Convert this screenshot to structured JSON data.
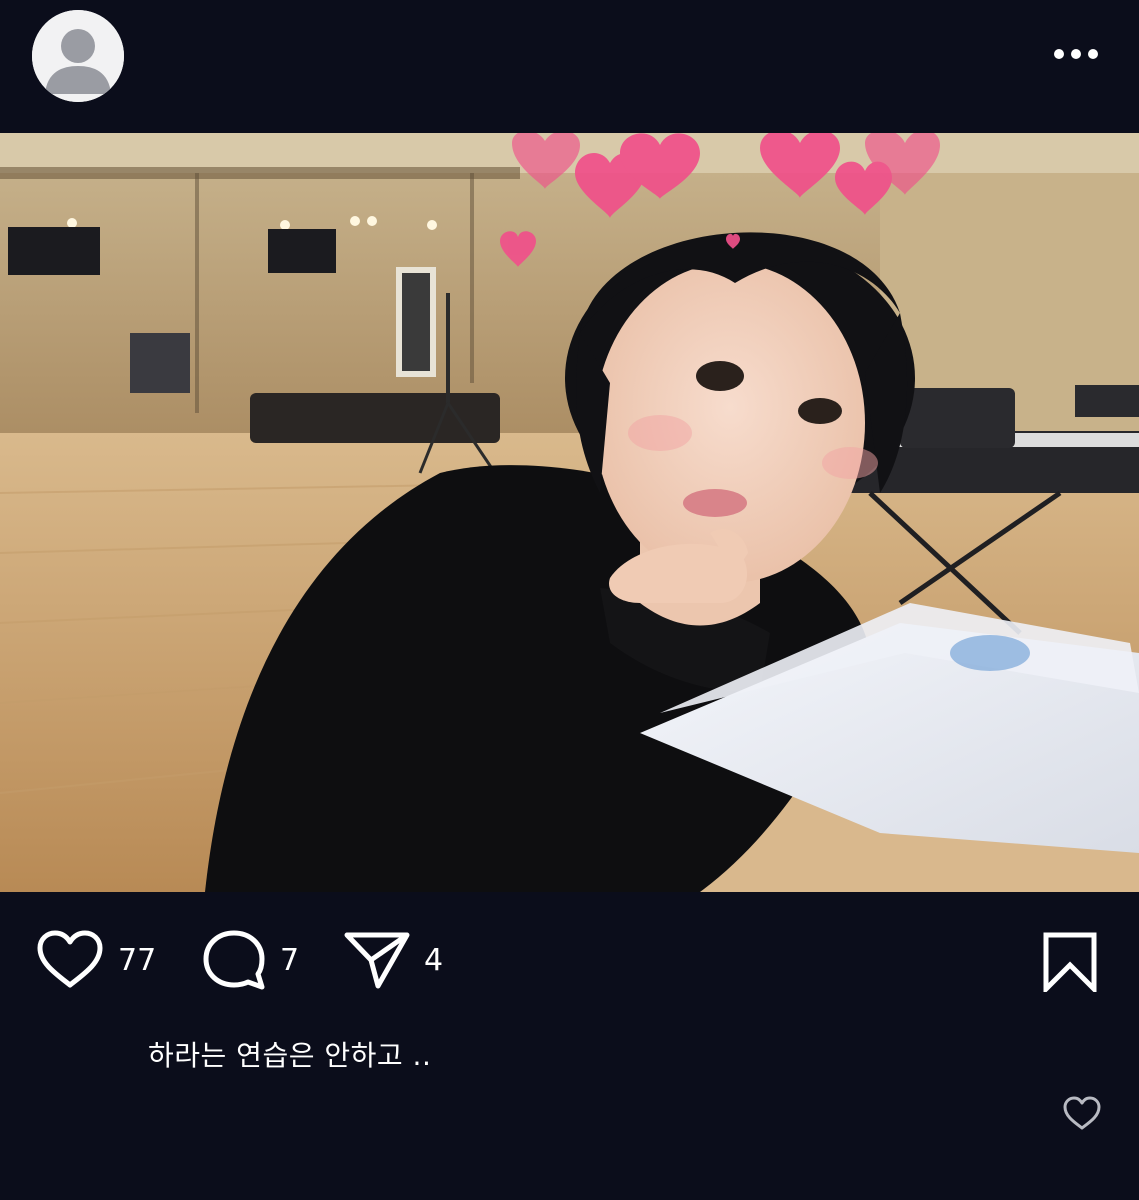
{
  "header": {
    "username": "",
    "avatar_icon": "default-user-avatar",
    "more_icon": "more-horizontal-icon"
  },
  "post": {
    "image_alt": "Selfie of a young woman with a pink hearts filter in a dance practice room",
    "like_icon": "heart-outline-icon",
    "comment_icon": "speech-bubble-icon",
    "share_icon": "paper-plane-icon",
    "bookmark_icon": "bookmark-outline-icon",
    "likes": "77",
    "comments": "7",
    "shares": "4",
    "caption": "하라는 연습은 안하고 .."
  },
  "colors": {
    "background": "#0b0d1b",
    "text": "#ffffff",
    "icon": "#ffffff"
  }
}
